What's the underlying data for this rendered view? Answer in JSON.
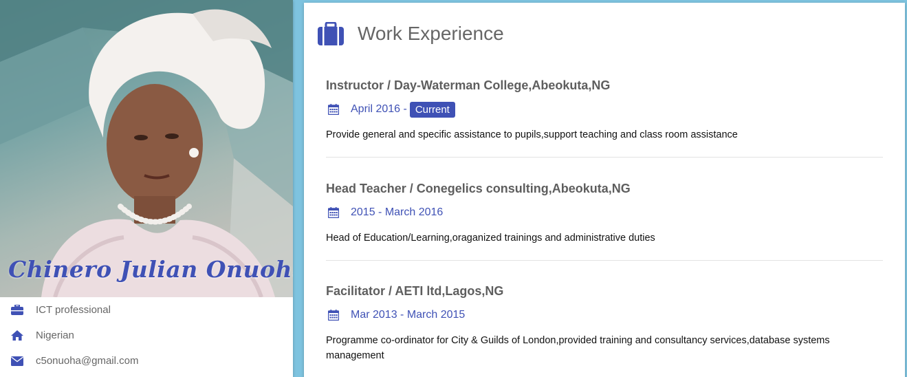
{
  "profile": {
    "name": "Chinero Julian Onuoha",
    "photo_alt": "profile-photo",
    "info": [
      {
        "icon": "briefcase-icon",
        "text": "ICT professional"
      },
      {
        "icon": "home-icon",
        "text": "Nigerian"
      },
      {
        "icon": "envelope-icon",
        "text": "c5onuoha@gmail.com"
      }
    ]
  },
  "work": {
    "title": "Work Experience",
    "jobs": [
      {
        "title": "Instructor / Day-Waterman College,Abeokuta,NG",
        "date": "April 2016 -",
        "tag": "Current",
        "description": "Provide general and specific assistance to pupils,support teaching and class room assistance"
      },
      {
        "title": "Head Teacher / Conegelics consulting,Abeokuta,NG",
        "date": "2015 - March 2016",
        "description": "Head of Education/Learning,oraganized trainings and administrative duties"
      },
      {
        "title": "Facilitator / AETI ltd,Lagos,NG",
        "date": "Mar 2013 - March 2015",
        "description": "Programme co-ordinator for City & Guilds of London,provided training and consultancy services,database systems management"
      }
    ]
  },
  "colors": {
    "accent": "#3f51b5",
    "background": "#7ec3df",
    "title_text": "#5e5e5e"
  }
}
